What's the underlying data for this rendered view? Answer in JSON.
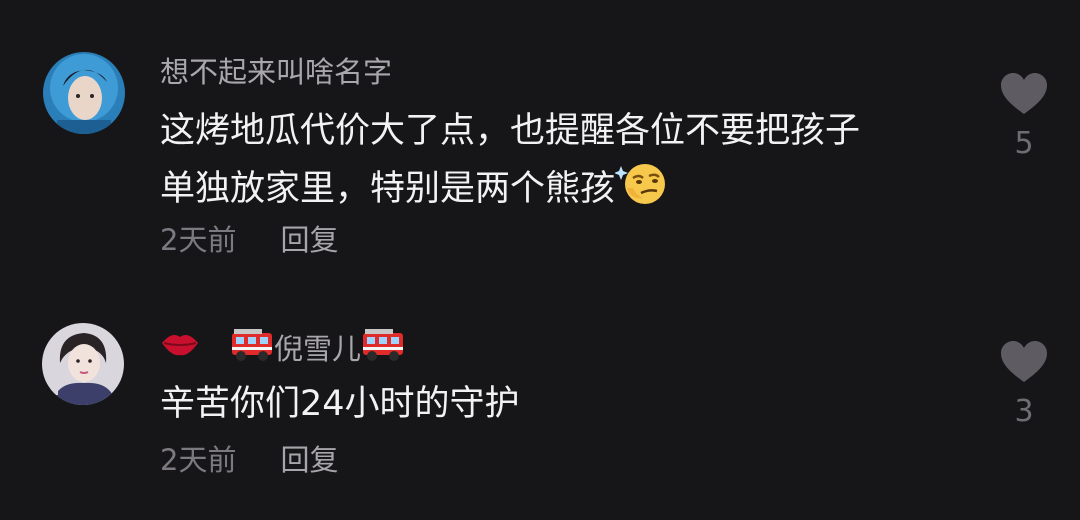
{
  "comments": [
    {
      "username": "想不起来叫啥名字",
      "text_line1": "这烤地瓜代价大了点，也提醒各位不要把孩子",
      "text_line2": "单独放家里，特别是两个熊孩",
      "emoji": "smirk-face-icon",
      "time": "2天前",
      "reply_label": "回复",
      "likes": "5"
    },
    {
      "username": "倪雪儿",
      "username_decorations": [
        "lips-emoji",
        "fire-engine-emoji",
        "fire-engine-emoji"
      ],
      "text": "辛苦你们24小时的守护",
      "time": "2天前",
      "reply_label": "回复",
      "likes": "3"
    }
  ],
  "colors": {
    "background": "#161517",
    "username": "#a9a7ac",
    "text": "#f2f1f3",
    "meta": "#7c7a80",
    "heart": "#5e5c62"
  }
}
